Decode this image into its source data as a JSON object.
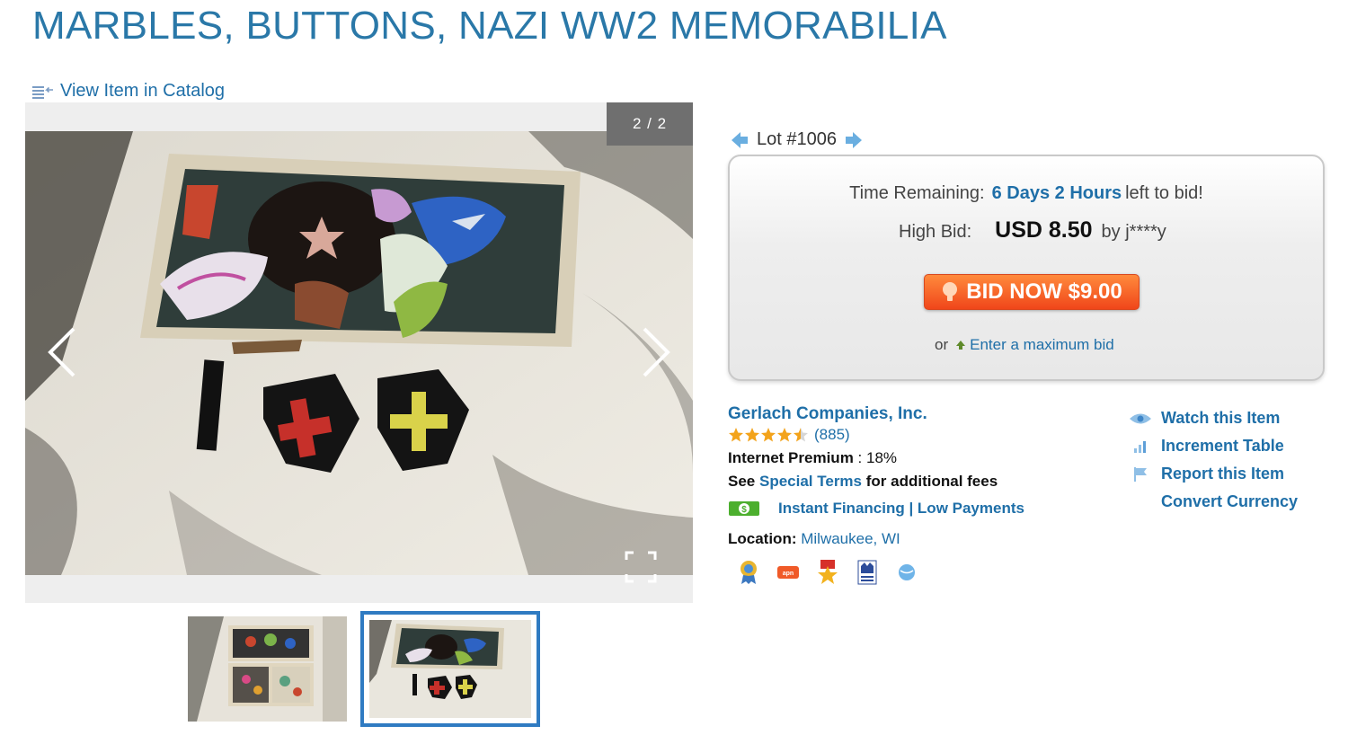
{
  "page": {
    "title": "MARBLES, BUTTONS, NAZI WW2 MEMORABILIA",
    "catalog_link": "View Item in Catalog"
  },
  "viewer": {
    "counter": "2 / 2",
    "current_image": 2,
    "total_images": 2,
    "thumbnail_count": 2,
    "selected_thumbnail": 2
  },
  "lot": {
    "label": "Lot #1006"
  },
  "bid_box": {
    "time_label": "Time Remaining:",
    "time_value": "6 Days 2 Hours",
    "time_suffix": "left to bid!",
    "high_bid_label": "High Bid:",
    "high_bid_amount": "USD 8.50",
    "high_bid_by": "by j****y",
    "bid_button": "BID NOW $9.00",
    "or_text": "or",
    "max_bid_link": "Enter a maximum bid"
  },
  "seller": {
    "name": "Gerlach Companies, Inc.",
    "rating_stars": 4.5,
    "rating_count": "(885)",
    "premium_label": "Internet Premium",
    "premium_value": ": 18%",
    "terms_prefix": "See",
    "terms_link": "Special Terms",
    "terms_suffix": "for additional fees",
    "financing": "Instant Financing | Low Payments",
    "location_label": "Location:",
    "location_value": "Milwaukee, WI"
  },
  "actions": {
    "watch": "Watch this Item",
    "increment": "Increment Table",
    "report": "Report this Item",
    "convert": "Convert Currency"
  },
  "colors": {
    "link": "#1f6fa8",
    "title": "#2a78a8",
    "bid_button": "#f0461a",
    "thumb_border": "#2f7bc2",
    "star": "#f3a31b"
  }
}
